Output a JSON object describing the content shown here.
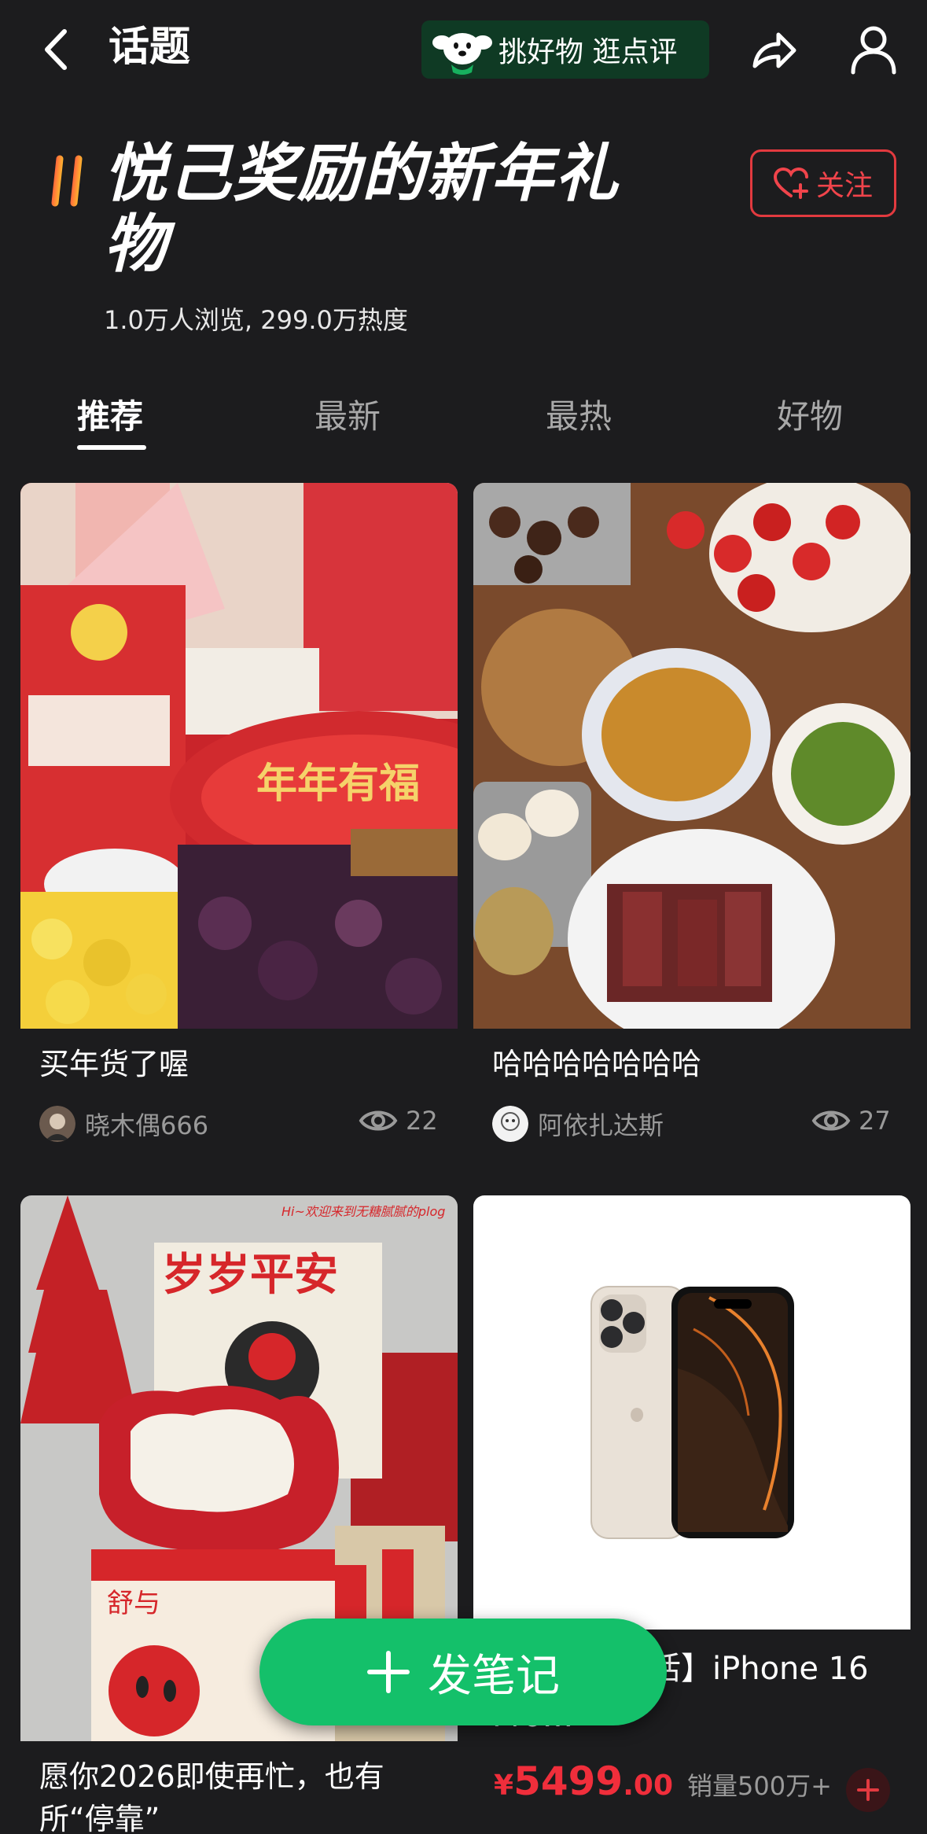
{
  "nav": {
    "title": "话题",
    "promo_text": "挑好物 逛点评"
  },
  "topic": {
    "title": "悦己奖励的新年礼物",
    "stats": "1.0万人浏览, 299.0万热度",
    "follow_label": "关注"
  },
  "tabs": [
    {
      "label": "推荐",
      "active": true
    },
    {
      "label": "最新",
      "active": false
    },
    {
      "label": "最热",
      "active": false
    },
    {
      "label": "好物",
      "active": false
    }
  ],
  "cards": [
    {
      "title": "买年货了喔",
      "author": "晓木偶666",
      "views": "22",
      "image_label": "年年有福"
    },
    {
      "title": "哈哈哈哈哈哈哈",
      "author": "阿依扎达斯",
      "views": "27"
    },
    {
      "title": "愿你2026即使再忙，也有所“停靠”",
      "image_label_top": "岁岁平安",
      "image_label_small": "Hi~欢迎来到无糖腻腻的plog",
      "image_label_box": "舒与"
    },
    {
      "title": "【需签收激活】iPhone 16 Pro…",
      "price_symbol": "¥",
      "price_main": "5499",
      "price_decimal": ".00",
      "sales": "销量500万+"
    }
  ],
  "fab": {
    "label": "发笔记"
  },
  "colors": {
    "accent_green": "#14c06a",
    "follow_red": "#e23a3f",
    "price_red": "#f02e3b",
    "background": "#1c1c1e"
  }
}
